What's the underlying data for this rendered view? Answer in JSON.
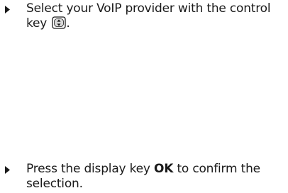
{
  "steps": [
    {
      "text_before": "Select your VoIP provider with the control key",
      "icon": "control-key-icon",
      "text_after": "."
    },
    {
      "text_before": "Press the display key",
      "key_label": "OK",
      "text_after": "to confirm the selection."
    }
  ]
}
